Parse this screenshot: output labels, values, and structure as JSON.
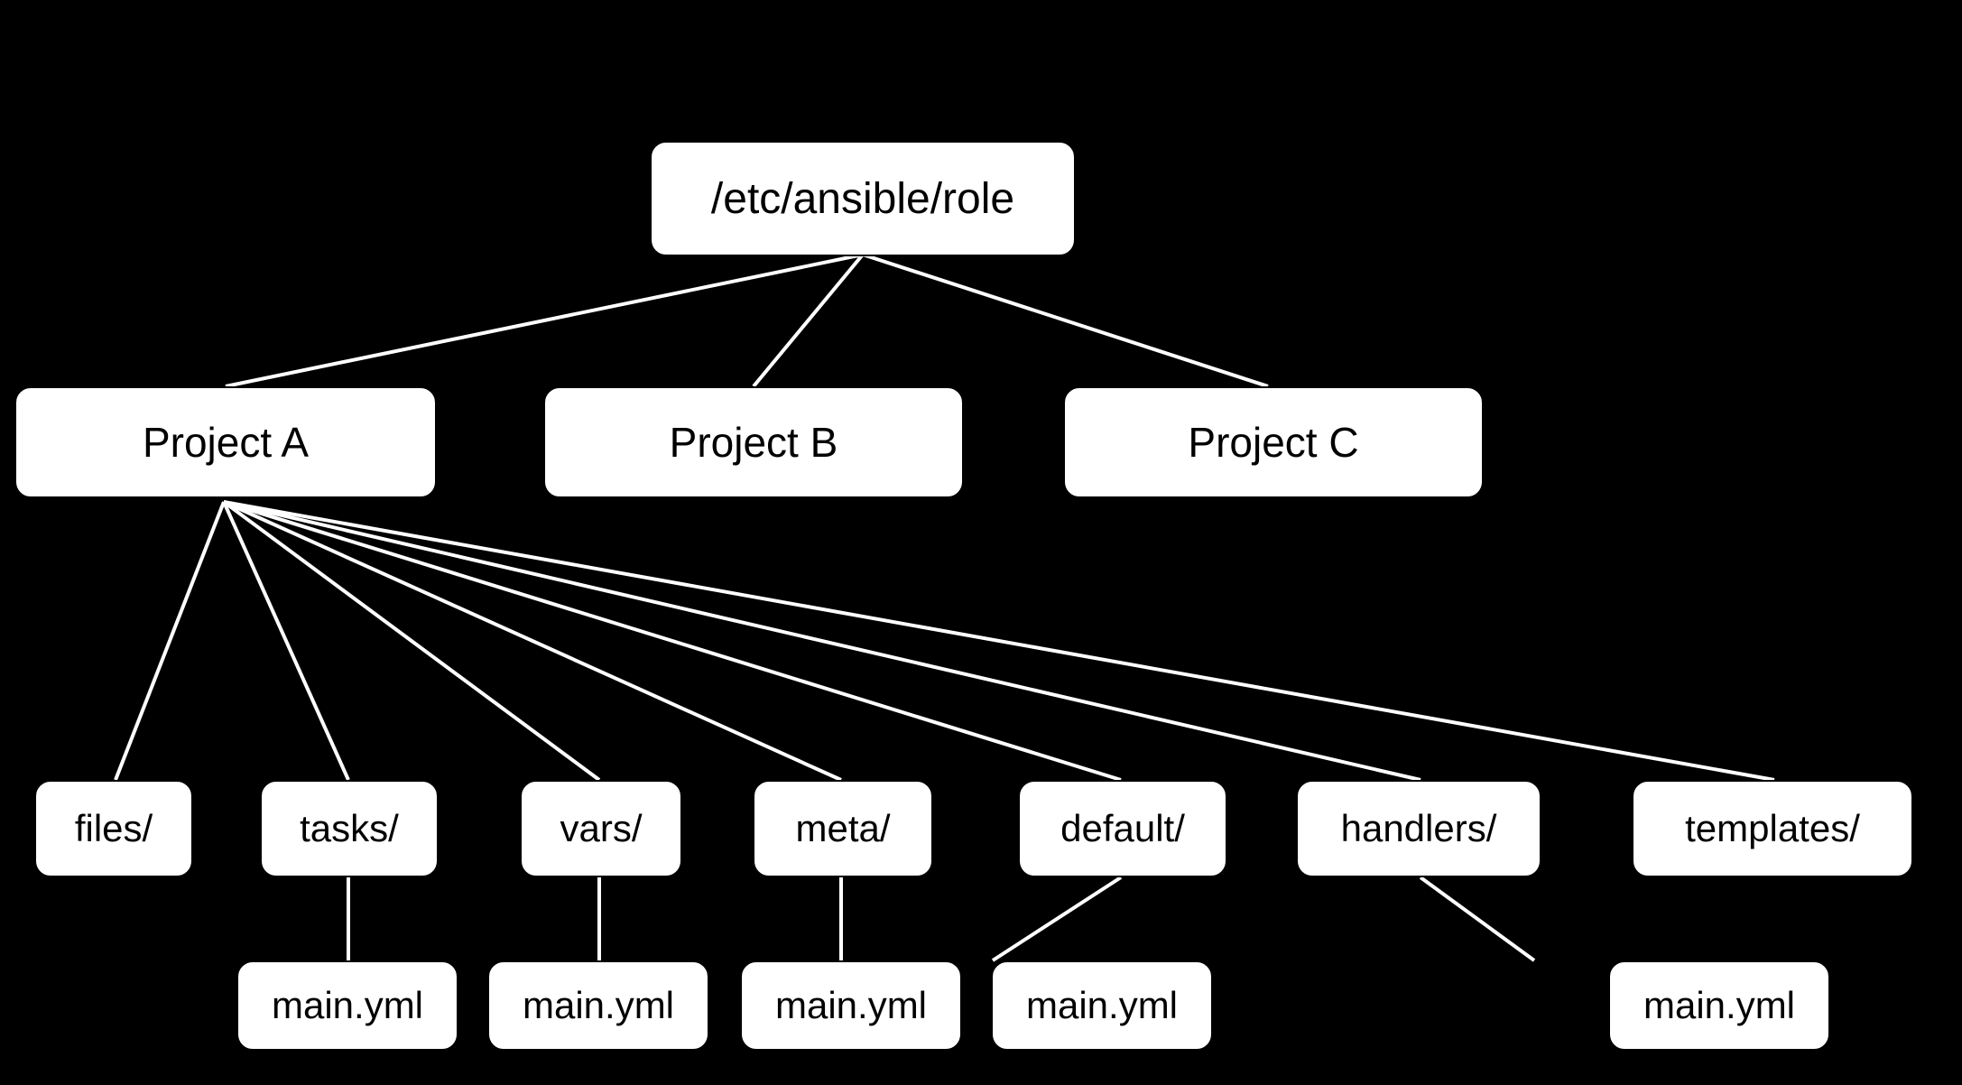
{
  "root": {
    "label": "/etc/ansible/role"
  },
  "projects": {
    "a": {
      "label": "Project A"
    },
    "b": {
      "label": "Project B"
    },
    "c": {
      "label": "Project C"
    }
  },
  "dirs": {
    "files": {
      "label": "files/"
    },
    "tasks": {
      "label": "tasks/"
    },
    "vars": {
      "label": "vars/"
    },
    "meta": {
      "label": "meta/"
    },
    "default": {
      "label": "default/"
    },
    "handlers": {
      "label": "handlers/"
    },
    "templates": {
      "label": "templates/"
    }
  },
  "files": {
    "tasks": {
      "label": "main.yml"
    },
    "vars": {
      "label": "main.yml"
    },
    "meta": {
      "label": "main.yml"
    },
    "default": {
      "label": "main.yml"
    },
    "handlers": {
      "label": "main.yml"
    }
  }
}
